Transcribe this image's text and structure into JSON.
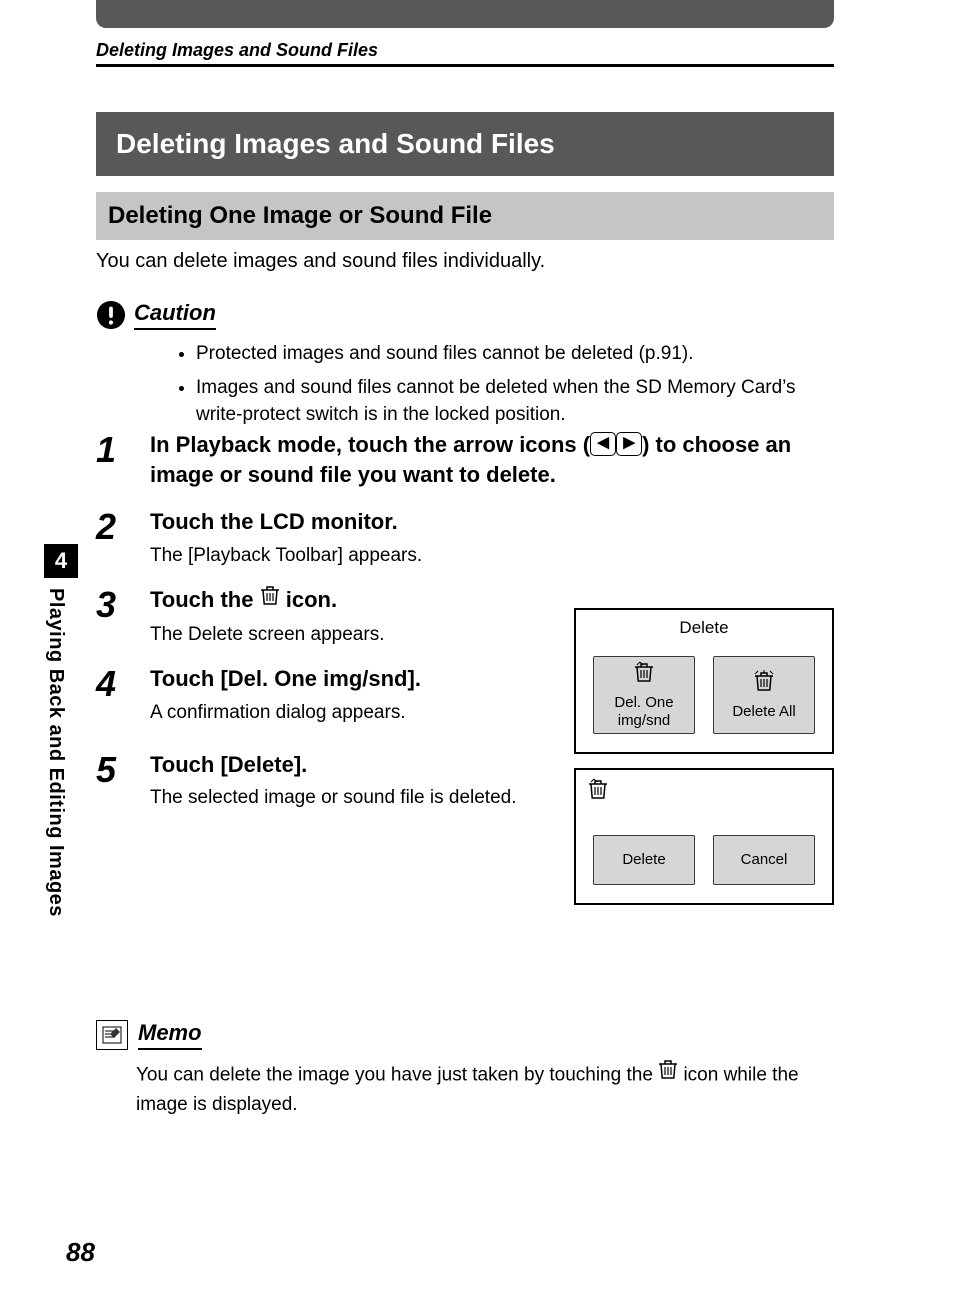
{
  "running_head": "Deleting Images and Sound Files",
  "section_title": "Deleting Images and Sound Files",
  "subsection_title": "Deleting One Image or Sound File",
  "intro": "You can delete images and sound files individually.",
  "caution": {
    "title": "Caution",
    "bullets": [
      "Protected images and sound files cannot be deleted (p.91).",
      "Images and sound files cannot be deleted when the SD Memory Card’s write-protect switch is in the locked position."
    ]
  },
  "steps": [
    {
      "num": "1",
      "instr_pre": "In Playback mode, touch the arrow icons (",
      "instr_post": ") to choose an image or sound file you want to delete.",
      "detail": ""
    },
    {
      "num": "2",
      "instr": "Touch the LCD monitor.",
      "detail": "The [Playback Toolbar] appears."
    },
    {
      "num": "3",
      "instr_pre": "Touch the ",
      "instr_post": " icon.",
      "detail": "The Delete screen appears."
    },
    {
      "num": "4",
      "instr": "Touch [Del. One img/snd].",
      "detail": "A confirmation dialog appears."
    },
    {
      "num": "5",
      "instr": "Touch [Delete].",
      "detail": "The selected image or sound file is deleted."
    }
  ],
  "side_tab": {
    "num": "4",
    "label": "Playing Back and Editing Images"
  },
  "screens": {
    "delete_screen": {
      "title": "Delete",
      "btn1_line1": "Del. One",
      "btn1_line2": "img/snd",
      "btn2": "Delete All"
    },
    "confirm_screen": {
      "btn1": "Delete",
      "btn2": "Cancel"
    }
  },
  "memo": {
    "title": "Memo",
    "text_pre": "You can delete the image you have just taken by touching the ",
    "text_post": " icon while the image is displayed."
  },
  "page_number": "88"
}
